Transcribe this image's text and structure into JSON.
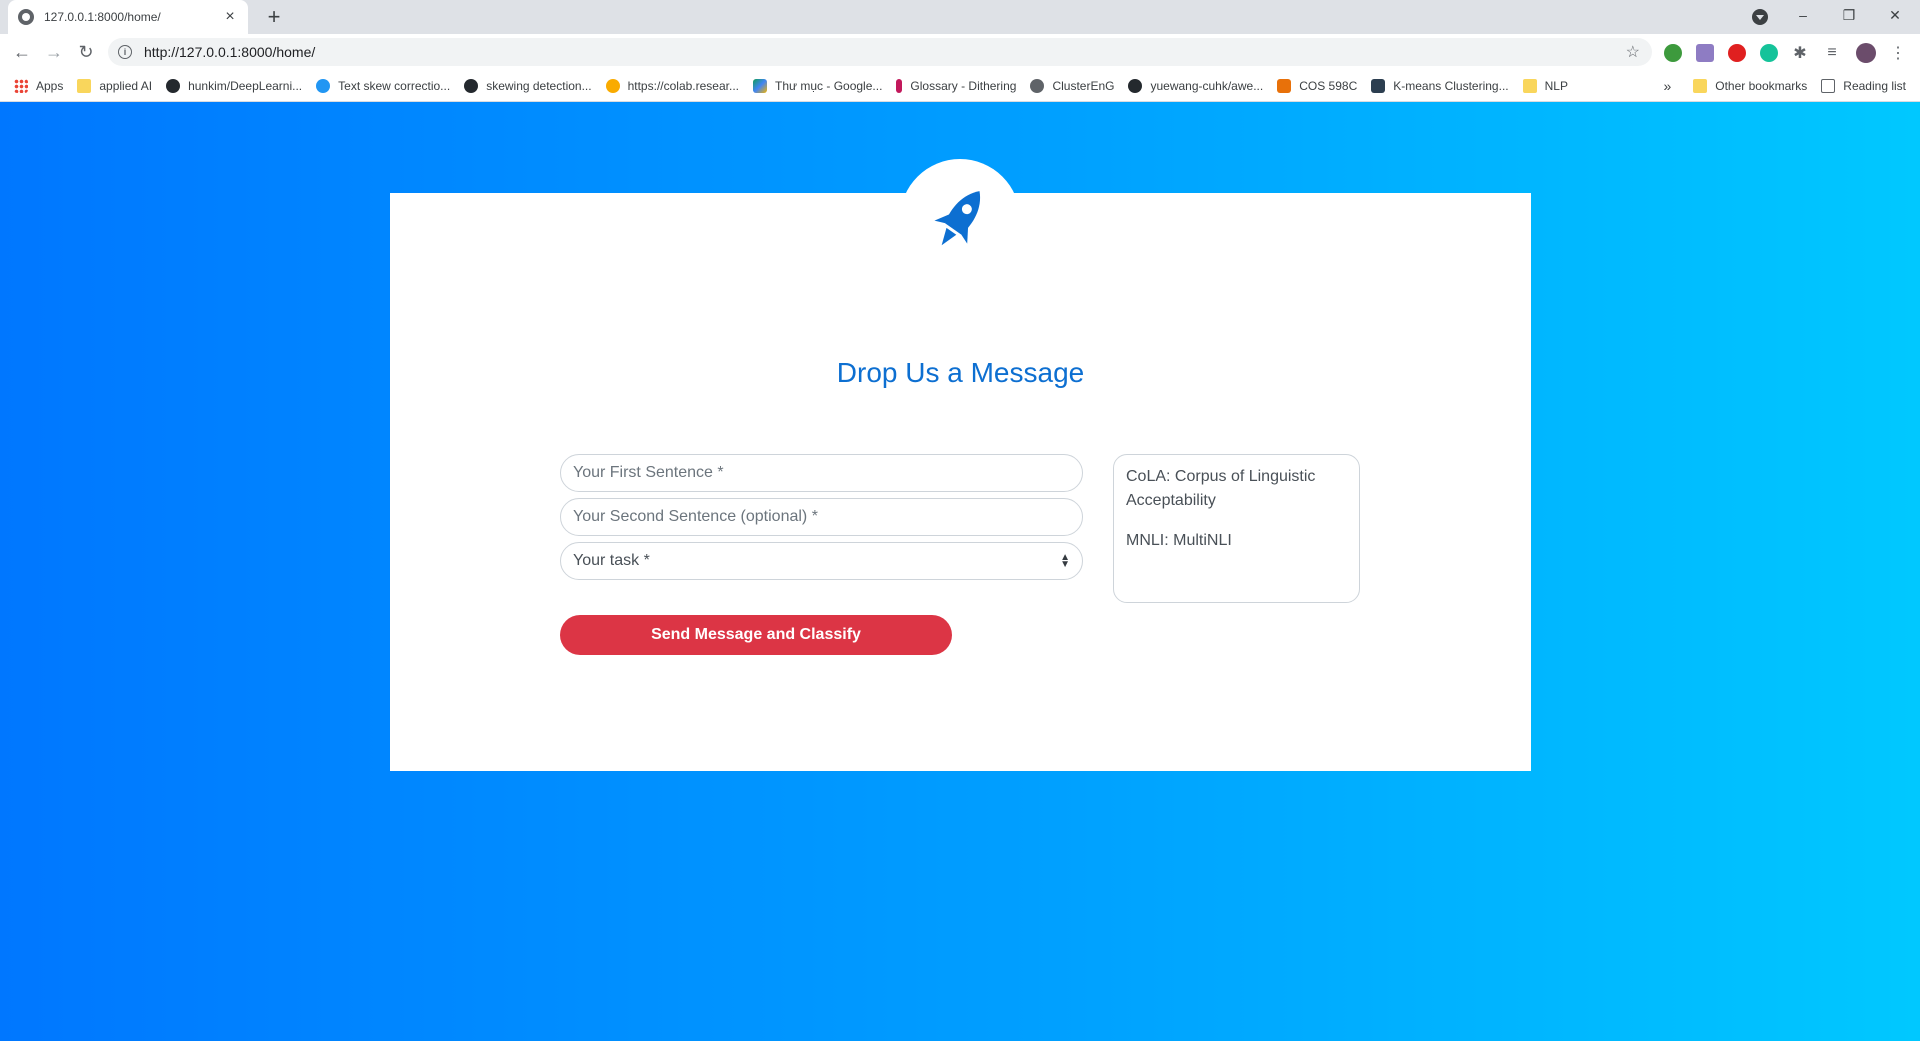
{
  "browser": {
    "tab_title": "127.0.0.1:8000/home/",
    "tab_close": "×",
    "new_tab": "+",
    "url": "http://127.0.0.1:8000/home/",
    "window_controls": {
      "minimize": "–",
      "restore": "❐",
      "close": "✕"
    }
  },
  "bookmarks": {
    "items": [
      "Apps",
      "applied AI",
      "hunkim/DeepLearni...",
      "Text skew correctio...",
      "skewing detection...",
      "https://colab.resear...",
      "Thư mục - Google...",
      "Glossary - Dithering",
      "ClusterEnG",
      "yuewang-cuhk/awe...",
      "COS 598C",
      "K-means Clustering...",
      "NLP"
    ],
    "overflow": "»",
    "other": "Other bookmarks",
    "reading_list": "Reading list"
  },
  "page": {
    "heading": "Drop Us a Message",
    "first_sentence_placeholder": "Your First Sentence *",
    "second_sentence_placeholder": "Your Second Sentence (optional) *",
    "task_select": "Your task *",
    "submit_label": "Send Message and Classify",
    "tasks_info": [
      "CoLA: Corpus of Linguistic Acceptability",
      "MNLI: MultiNLI"
    ]
  },
  "colors": {
    "accent": "#0d6fd1",
    "button": "#dc3545",
    "bg_gradient_start": "#0077ff",
    "bg_gradient_end": "#00c8ff"
  }
}
